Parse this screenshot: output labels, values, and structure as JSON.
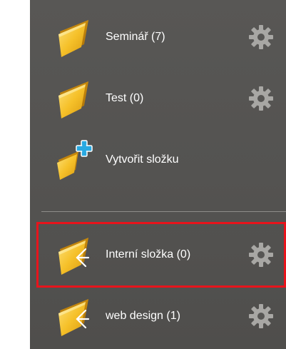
{
  "folders": [
    {
      "label": "Seminář (7)",
      "type": "folder"
    },
    {
      "label": "Test (0)",
      "type": "folder"
    }
  ],
  "create_folder": {
    "label": "Vytvořit složku",
    "icon": "folder-plus-icon"
  },
  "shared_folders": [
    {
      "label": "Interní složka (0)",
      "type": "shared-folder"
    },
    {
      "label": "web design (1)",
      "type": "shared-folder"
    }
  ],
  "icons": {
    "folder": "folder-icon",
    "shared_folder": "shared-folder-icon",
    "settings": "gear-icon"
  },
  "colors": {
    "panel_background": "#565553",
    "label_text": "#ffffff",
    "folder_yellow": "#f6c12a",
    "plus_blue": "#29a9e1",
    "gear_gray": "#a8a7a4",
    "highlight_border": "#e8141c",
    "divider": "#8e8d8a"
  }
}
